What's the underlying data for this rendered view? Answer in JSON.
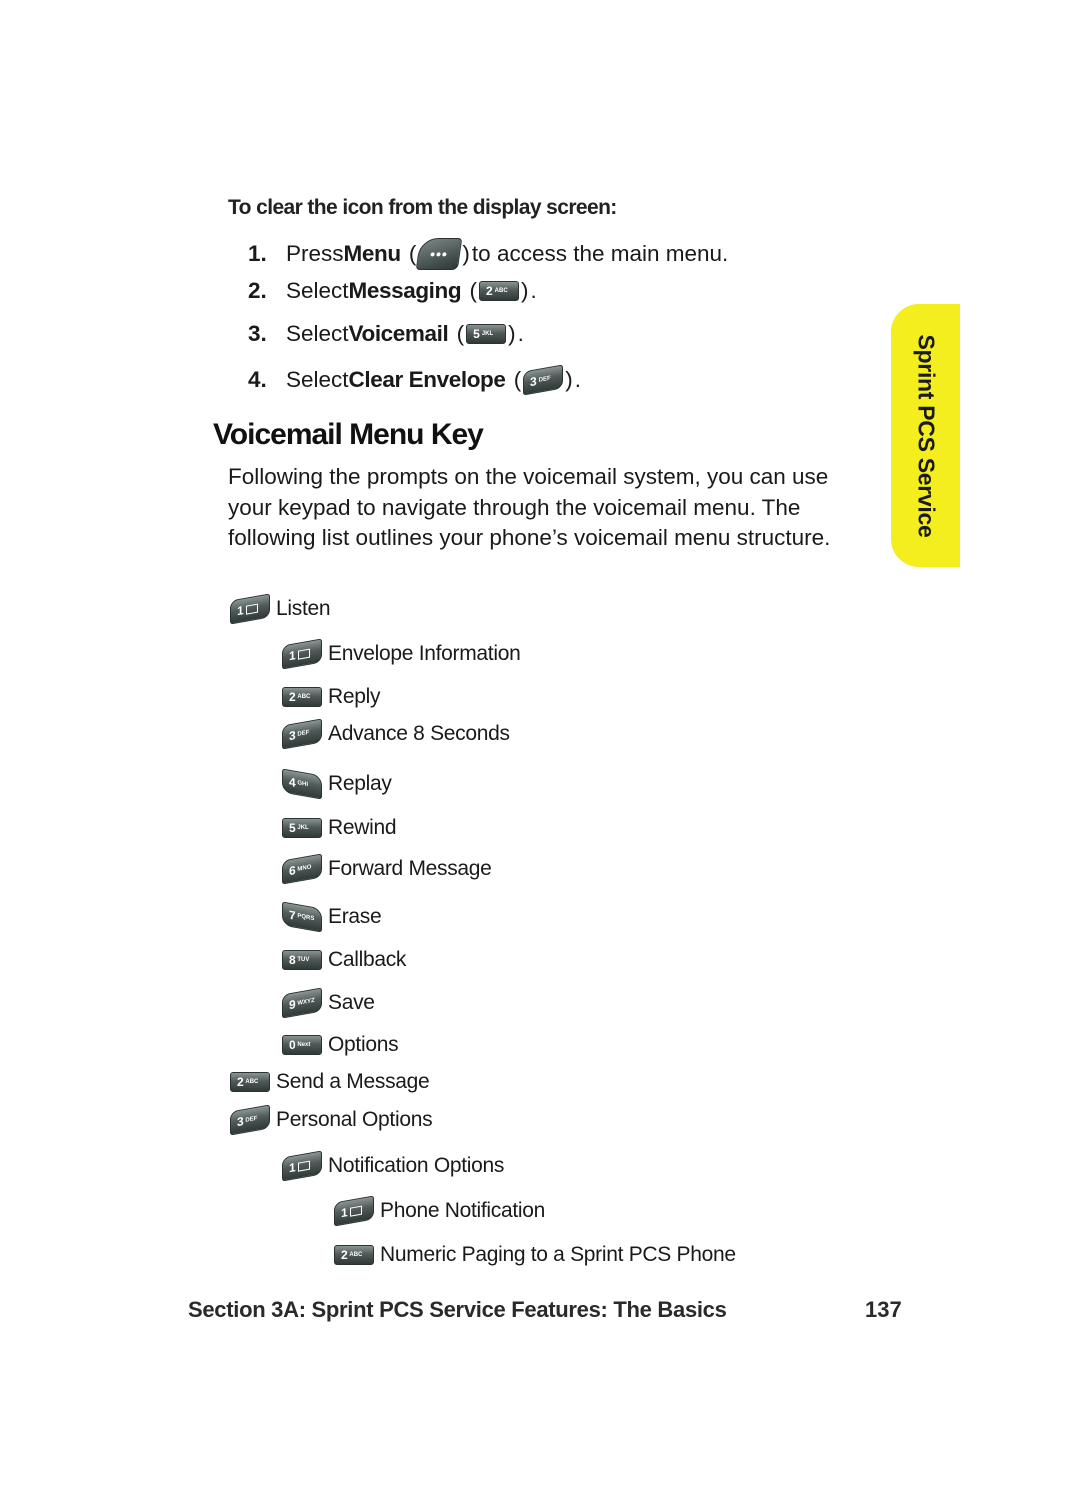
{
  "instructions": {
    "subheading": "To clear the icon from the display screen:",
    "steps": [
      {
        "num": "1.",
        "pre": "Press ",
        "bold": "Menu",
        "key": {
          "icon": "menu-key-icon",
          "digit": "•••",
          "letters": ""
        },
        "post": " to access the main menu."
      },
      {
        "num": "2.",
        "pre": "Select ",
        "bold": "Messaging",
        "key": {
          "icon": "key-2-icon",
          "digit": "2",
          "letters": "ABC"
        },
        "post": "."
      },
      {
        "num": "3.",
        "pre": "Select ",
        "bold": "Voicemail",
        "key": {
          "icon": "key-5-icon",
          "digit": "5",
          "letters": "JKL"
        },
        "post": "."
      },
      {
        "num": "4.",
        "pre": "Select ",
        "bold": "Clear Envelope",
        "key": {
          "icon": "key-3-icon",
          "digit": "3",
          "letters": "DEF"
        },
        "post": "."
      }
    ]
  },
  "section": {
    "heading": "Voicemail Menu Key",
    "paragraph": "Following the prompts on the voicemail system, you can use your keypad to navigate through the voicemail menu. The following list outlines your phone’s voicemail menu structure."
  },
  "side_tab": {
    "label": "Sprint PCS Service",
    "color": "#f4ee1e"
  },
  "menu_tree": [
    {
      "level": 0,
      "digit": "1",
      "letters": "✉",
      "icon": "key-1-envelope-icon",
      "label": "Listen"
    },
    {
      "level": 1,
      "digit": "1",
      "letters": "✉",
      "icon": "key-1-envelope-icon",
      "label": "Envelope Information"
    },
    {
      "level": 1,
      "digit": "2",
      "letters": "ABC",
      "icon": "key-2-icon",
      "label": "Reply"
    },
    {
      "level": 1,
      "digit": "3",
      "letters": "DEF",
      "icon": "key-3-icon",
      "label": "Advance 8 Seconds"
    },
    {
      "level": 1,
      "digit": "4",
      "letters": "GHI",
      "icon": "key-4-icon",
      "label": "Replay"
    },
    {
      "level": 1,
      "digit": "5",
      "letters": "JKL",
      "icon": "key-5-icon",
      "label": "Rewind"
    },
    {
      "level": 1,
      "digit": "6",
      "letters": "MNO",
      "icon": "key-6-icon",
      "label": "Forward Message"
    },
    {
      "level": 1,
      "digit": "7",
      "letters": "PQRS",
      "icon": "key-7-icon",
      "label": "Erase"
    },
    {
      "level": 1,
      "digit": "8",
      "letters": "TUV",
      "icon": "key-8-icon",
      "label": "Callback"
    },
    {
      "level": 1,
      "digit": "9",
      "letters": "WXYZ",
      "icon": "key-9-icon",
      "label": "Save"
    },
    {
      "level": 1,
      "digit": "0",
      "letters": "Next",
      "icon": "key-0-icon",
      "label": "Options"
    },
    {
      "level": 0,
      "digit": "2",
      "letters": "ABC",
      "icon": "key-2-icon",
      "label": "Send a Message"
    },
    {
      "level": 0,
      "digit": "3",
      "letters": "DEF",
      "icon": "key-3-icon",
      "label": "Personal Options"
    },
    {
      "level": 1,
      "digit": "1",
      "letters": "✉",
      "icon": "key-1-envelope-icon",
      "label": "Notification Options"
    },
    {
      "level": 2,
      "digit": "1",
      "letters": "✉",
      "icon": "key-1-envelope-icon",
      "label": "Phone Notification"
    },
    {
      "level": 2,
      "digit": "2",
      "letters": "ABC",
      "icon": "key-2-icon",
      "label": "Numeric Paging to a Sprint PCS Phone"
    }
  ],
  "footer": {
    "section_label": "Section 3A: Sprint PCS Service Features: The Basics",
    "page_number": "137"
  }
}
